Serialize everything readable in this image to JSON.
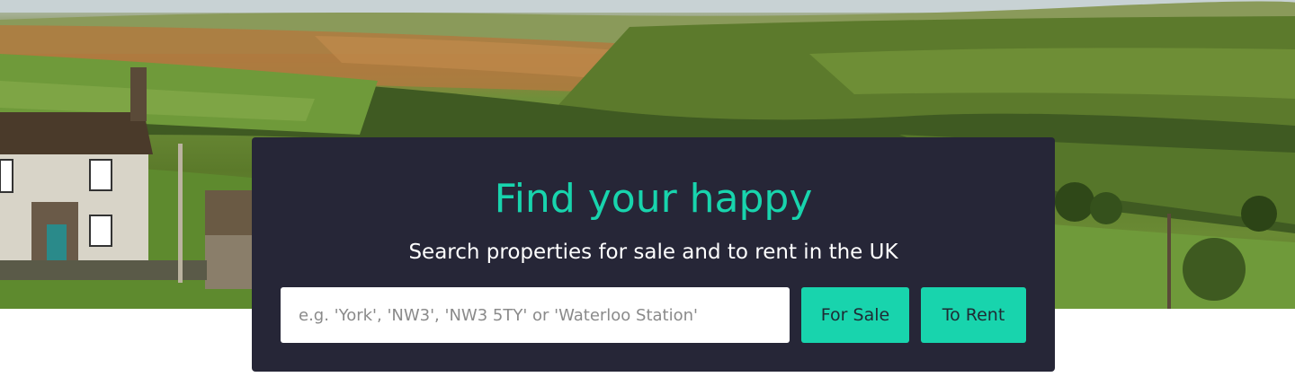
{
  "hero": {
    "title": "Find your happy",
    "subtitle": "Search properties for sale and to rent in the UK"
  },
  "search": {
    "placeholder": "e.g. 'York', 'NW3', 'NW3 5TY' or 'Waterloo Station'",
    "value": ""
  },
  "buttons": {
    "for_sale": "For Sale",
    "to_rent": "To Rent"
  },
  "colors": {
    "accent": "#18d4ad",
    "panel": "#262637",
    "text_light": "#ffffff"
  }
}
